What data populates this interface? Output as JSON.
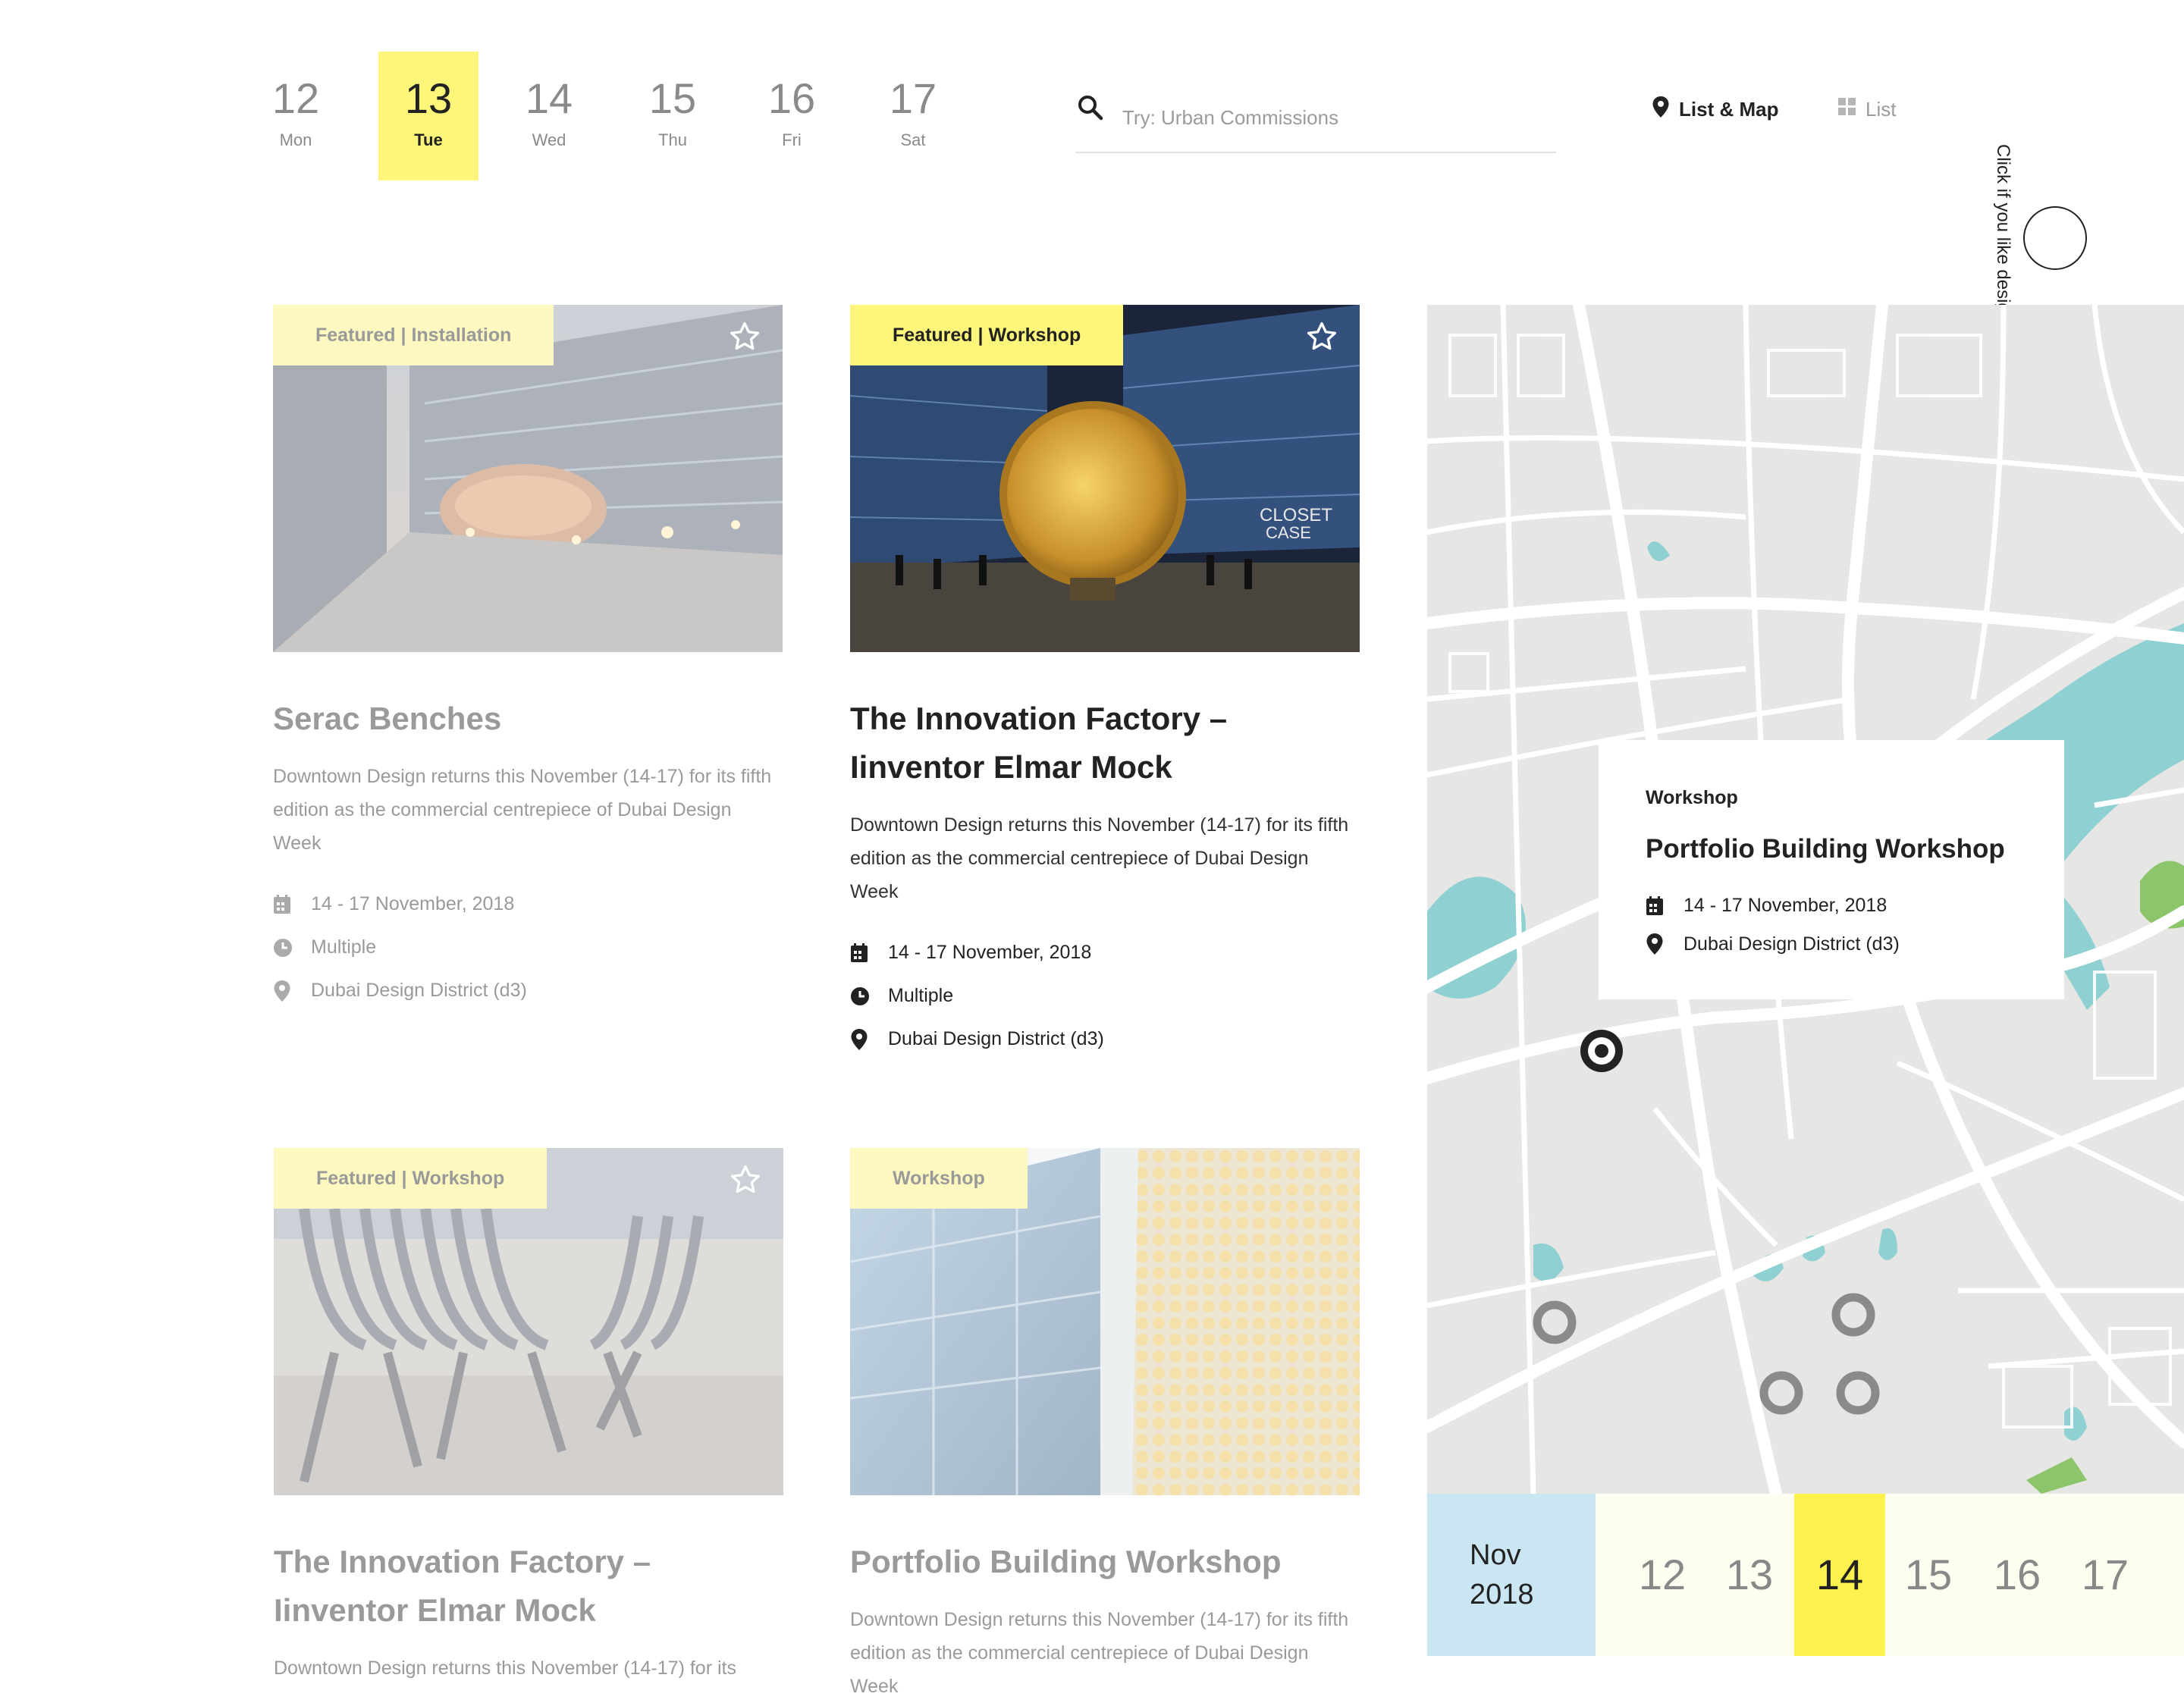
{
  "date_bar": [
    {
      "num": "12",
      "day": "Mon"
    },
    {
      "num": "13",
      "day": "Tue",
      "active": true
    },
    {
      "num": "14",
      "day": "Wed"
    },
    {
      "num": "15",
      "day": "Thu"
    },
    {
      "num": "16",
      "day": "Fri"
    },
    {
      "num": "17",
      "day": "Sat"
    }
  ],
  "search": {
    "placeholder": "Try: Urban Commissions"
  },
  "view": {
    "list_map": "List & Map",
    "list": "List"
  },
  "side_link": "Click if you like design",
  "cards": [
    {
      "tag": "Featured | Installation",
      "title": "Serac Benches",
      "desc": "Downtown Design returns this November (14-17) for its fifth edition as the commercial centrepiece of Dubai Design Week",
      "date": "14 - 17 November, 2018",
      "time": "Multiple",
      "location": "Dubai Design District (d3)"
    },
    {
      "tag": "Featured | Workshop",
      "title": "The Innovation Factory – Iinventor Elmar Mock",
      "desc": "Downtown Design returns this November (14-17) for its fifth edition as the commercial centrepiece of Dubai Design Week",
      "date": "14 - 17 November, 2018",
      "time": "Multiple",
      "location": "Dubai Design District (d3)"
    },
    {
      "tag": "Featured | Workshop",
      "title": "The Innovation Factory – Iinventor Elmar Mock",
      "desc": "Downtown Design returns this November (14-17) for its"
    },
    {
      "tag": "Workshop",
      "title": "Portfolio Building Workshop",
      "desc": "Downtown Design returns this November (14-17) for its fifth edition as the commercial centrepiece of Dubai Design Week"
    }
  ],
  "map_popup": {
    "type": "Workshop",
    "title": "Portfolio Building Workshop",
    "date": "14 - 17 November, 2018",
    "location": "Dubai Design District (d3)"
  },
  "bottom_strip": {
    "month": "Nov",
    "year": "2018",
    "days": [
      "12",
      "13",
      "14",
      "15",
      "16",
      "17"
    ],
    "active_day": "14"
  },
  "colors": {
    "accent_yellow": "#fdf67a",
    "month_blue": "#cbe6f3",
    "water": "#8fd1d2"
  },
  "icons": [
    "search-icon",
    "pin-icon",
    "grid-icon",
    "star-icon",
    "calendar-icon",
    "clock-icon",
    "target-marker-icon",
    "ring-marker-icon"
  ]
}
